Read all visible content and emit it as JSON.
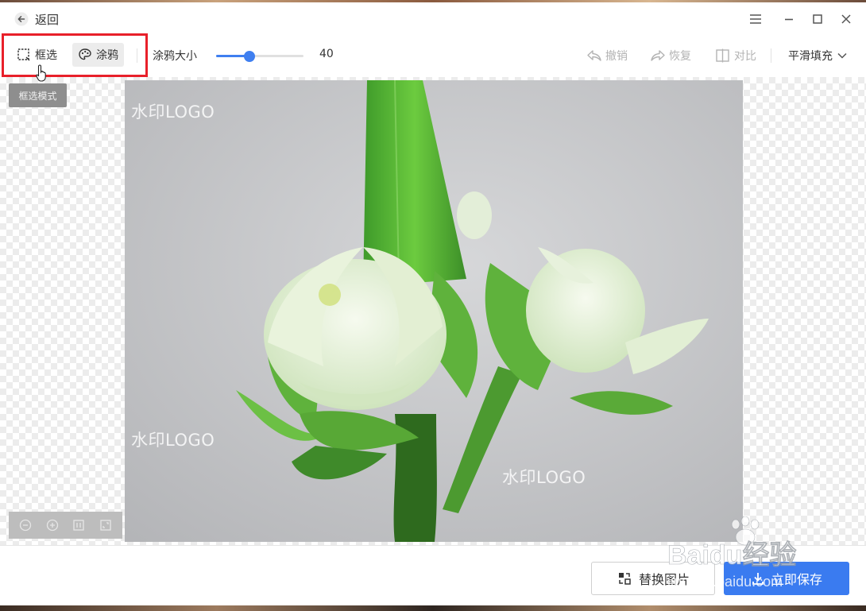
{
  "header": {
    "back_label": "返回"
  },
  "toolbar": {
    "box_select_label": "框选",
    "doodle_label": "涂鸦",
    "brush_size_label": "涂鸦大小",
    "brush_size_value": "40",
    "brush_size_fraction": 0.38,
    "undo_label": "撤销",
    "redo_label": "恢复",
    "compare_label": "对比",
    "fill_mode_label": "平滑填充"
  },
  "canvas": {
    "tooltip_label": "框选模式",
    "watermarks": [
      "水印LOGO",
      "水印LOGO",
      "水印LOGO"
    ]
  },
  "footer": {
    "replace_label": "替换图片",
    "save_label": "立即保存"
  },
  "overlay": {
    "site_watermark": "Baidu经验",
    "site_url": "jingyan.baidu.com"
  },
  "colors": {
    "accent": "#3a7bf0",
    "highlight": "#e8202a"
  },
  "icons": [
    "back-arrow-icon",
    "menu-icon",
    "minimize-icon",
    "maximize-icon",
    "close-icon",
    "box-select-icon",
    "palette-icon",
    "undo-icon",
    "redo-icon",
    "compare-icon",
    "chevron-down-icon",
    "zoom-out-icon",
    "zoom-in-icon",
    "fit-icon",
    "fullscreen-icon",
    "replace-icon",
    "download-icon"
  ]
}
